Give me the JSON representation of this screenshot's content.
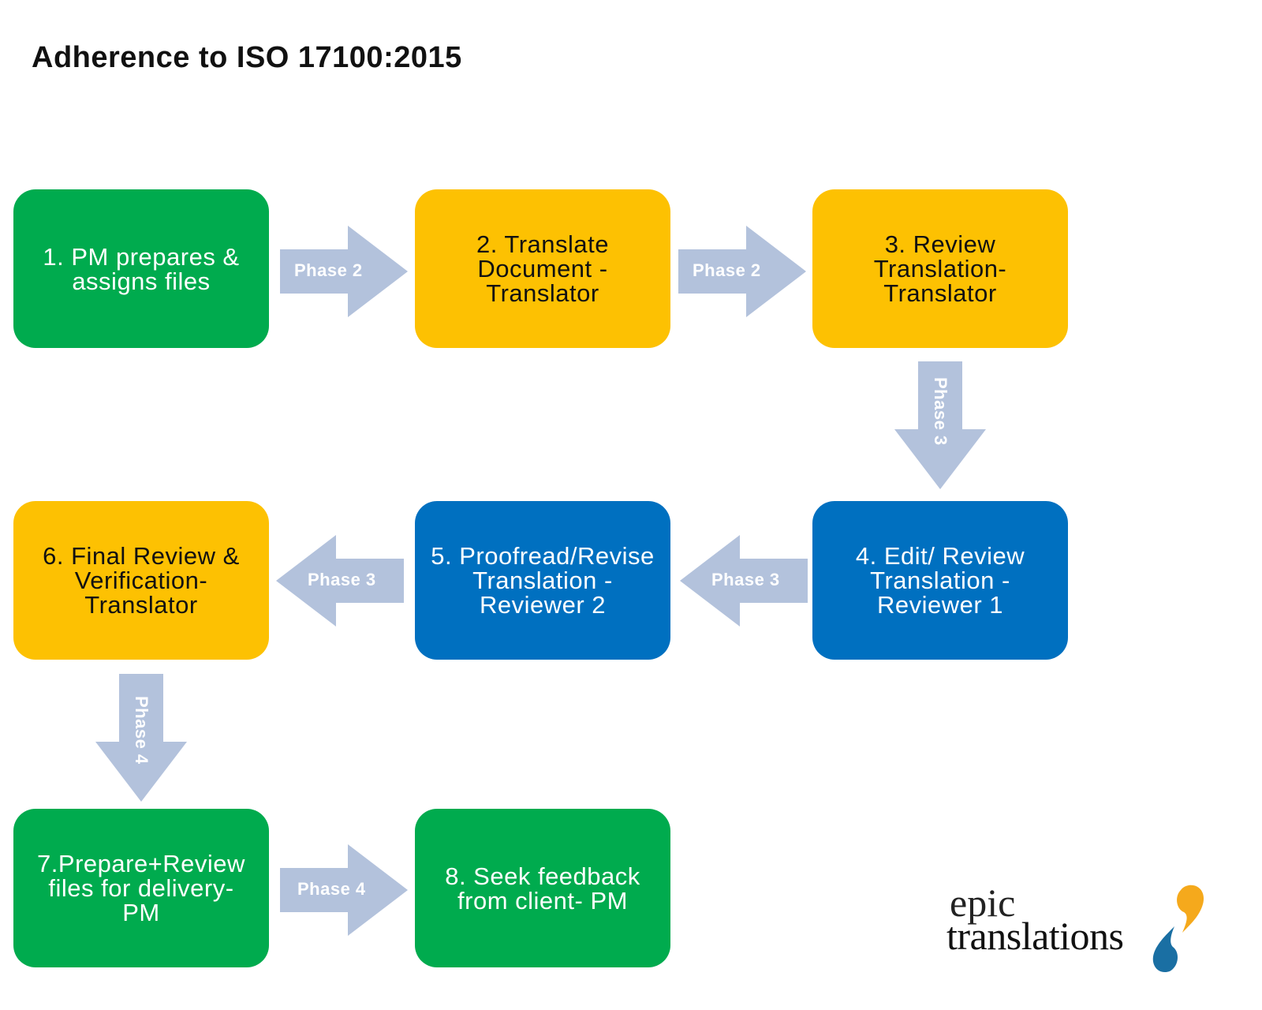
{
  "title": "Adherence to ISO 17100:2015",
  "colors": {
    "pm_green": "#00ab4e",
    "translator_yellow": "#fdc102",
    "reviewer_blue": "#0070c0",
    "arrow_gray_blue": "#b3c2dc",
    "logo_orange": "#f5a91c",
    "logo_blue": "#1a6fa3"
  },
  "steps": [
    {
      "number": 1,
      "label": "1. PM prepares &\nassigns files",
      "color": "green"
    },
    {
      "number": 2,
      "label": "2. Translate\nDocument -\nTranslator",
      "color": "yellow"
    },
    {
      "number": 3,
      "label": "3. Review\nTranslation-\nTranslator",
      "color": "yellow"
    },
    {
      "number": 4,
      "label": "4. Edit/ Review\nTranslation -\nReviewer 1",
      "color": "blue"
    },
    {
      "number": 5,
      "label": "5. Proofread/Revise\nTranslation -\nReviewer 2",
      "color": "blue"
    },
    {
      "number": 6,
      "label": "6. Final Review &\nVerification-\nTranslator",
      "color": "yellow"
    },
    {
      "number": 7,
      "label": "7.Prepare+Review\nfiles for delivery-\nPM",
      "color": "green"
    },
    {
      "number": 8,
      "label": "8. Seek feedback\nfrom client- PM",
      "color": "green"
    }
  ],
  "connectors": [
    {
      "from": 1,
      "to": 2,
      "label": "Phase 2",
      "direction": "right"
    },
    {
      "from": 2,
      "to": 3,
      "label": "Phase 2",
      "direction": "right"
    },
    {
      "from": 3,
      "to": 4,
      "label": "Phase 3",
      "direction": "down"
    },
    {
      "from": 4,
      "to": 5,
      "label": "Phase 3",
      "direction": "left"
    },
    {
      "from": 5,
      "to": 6,
      "label": "Phase 3",
      "direction": "left"
    },
    {
      "from": 6,
      "to": 7,
      "label": "Phase 4",
      "direction": "down"
    },
    {
      "from": 7,
      "to": 8,
      "label": "Phase 4",
      "direction": "right"
    }
  ],
  "logo": {
    "line1": "epic",
    "line2": "translations"
  }
}
